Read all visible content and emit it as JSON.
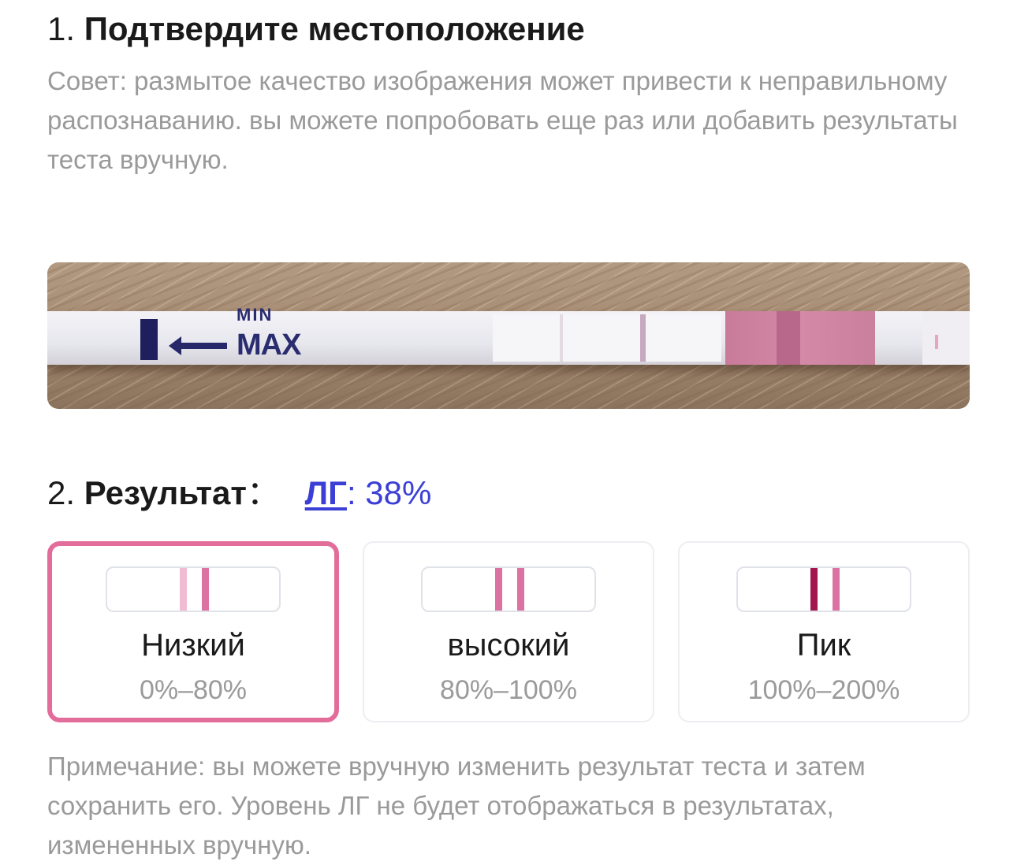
{
  "step1": {
    "number": "1.",
    "title": "Подтвердите местоположение",
    "tip": "Совет: размытое качество изображения может привести к неправильному распознаванию. вы можете попробовать еще раз или добавить результаты теста вручную."
  },
  "strip_photo": {
    "printed_text_top": "MIN",
    "printed_text": "MAX"
  },
  "step2": {
    "number": "2.",
    "title": "Результат",
    "separator": "：",
    "lh_label": "ЛГ",
    "lh_value": ": 38%"
  },
  "options": [
    {
      "label": "Низкий",
      "range": "0%–80%",
      "selected": true,
      "test_line_color": "#efbcd3",
      "control_line_color": "#db72a2"
    },
    {
      "label": "высокий",
      "range": "80%–100%",
      "selected": false,
      "test_line_color": "#db72a2",
      "control_line_color": "#db72a2"
    },
    {
      "label": "Пик",
      "range": "100%–200%",
      "selected": false,
      "test_line_color": "#a3174f",
      "control_line_color": "#db72a2"
    }
  ],
  "note": "Примечание: вы можете вручную изменить результат теста и затем сохранить его. Уровень ЛГ не будет отображаться в результатах, измененных вручную.",
  "colors": {
    "accent_blue": "#3b3fd6",
    "selected_border": "#e36d9a"
  }
}
